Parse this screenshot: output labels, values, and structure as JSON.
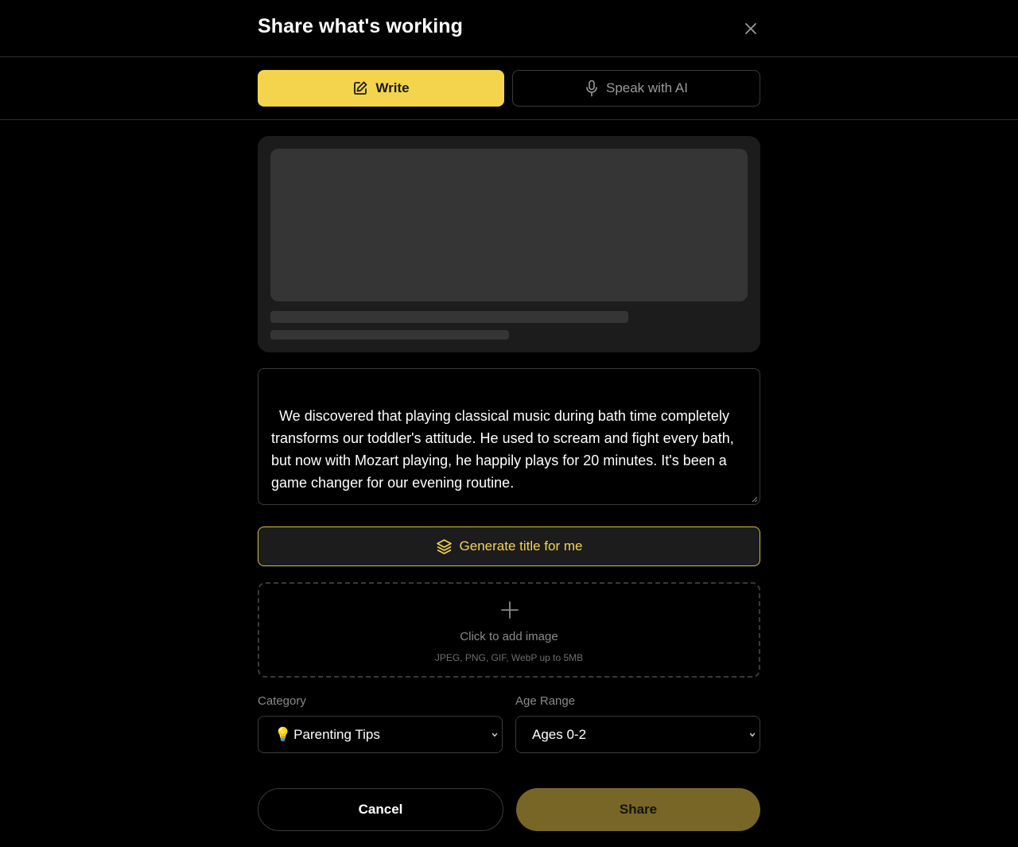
{
  "header": {
    "title": "Share what's working"
  },
  "mode": {
    "write_label": "Write",
    "speak_label": "Speak with AI",
    "active": "write"
  },
  "story": {
    "text": "We discovered that playing classical music during bath time completely transforms our toddler's attitude. He used to scream and fight every bath, but now with Mozart playing, he happily plays for 20 minutes. It's been a game changer for our evening routine."
  },
  "generate": {
    "label": "Generate title for me"
  },
  "upload": {
    "label": "Click to add image",
    "hint": "JPEG, PNG, GIF, WebP up to 5MB"
  },
  "category": {
    "label": "Category",
    "selected_icon": "💡",
    "selected": "Parenting Tips"
  },
  "age_range": {
    "label": "Age Range",
    "selected": "Ages 0-2"
  },
  "actions": {
    "cancel_label": "Cancel",
    "share_label": "Share"
  },
  "colors": {
    "accent": "#f4d44d",
    "share_disabled": "#776626",
    "background": "#000000",
    "card": "#1c1c1c",
    "border": "#3a3a3a"
  },
  "icons": {
    "close": "close-icon",
    "write": "pencil-square-icon",
    "speak": "microphone-icon",
    "generate": "layers-icon",
    "upload": "plus-icon",
    "select": "chevron-down-icon"
  }
}
